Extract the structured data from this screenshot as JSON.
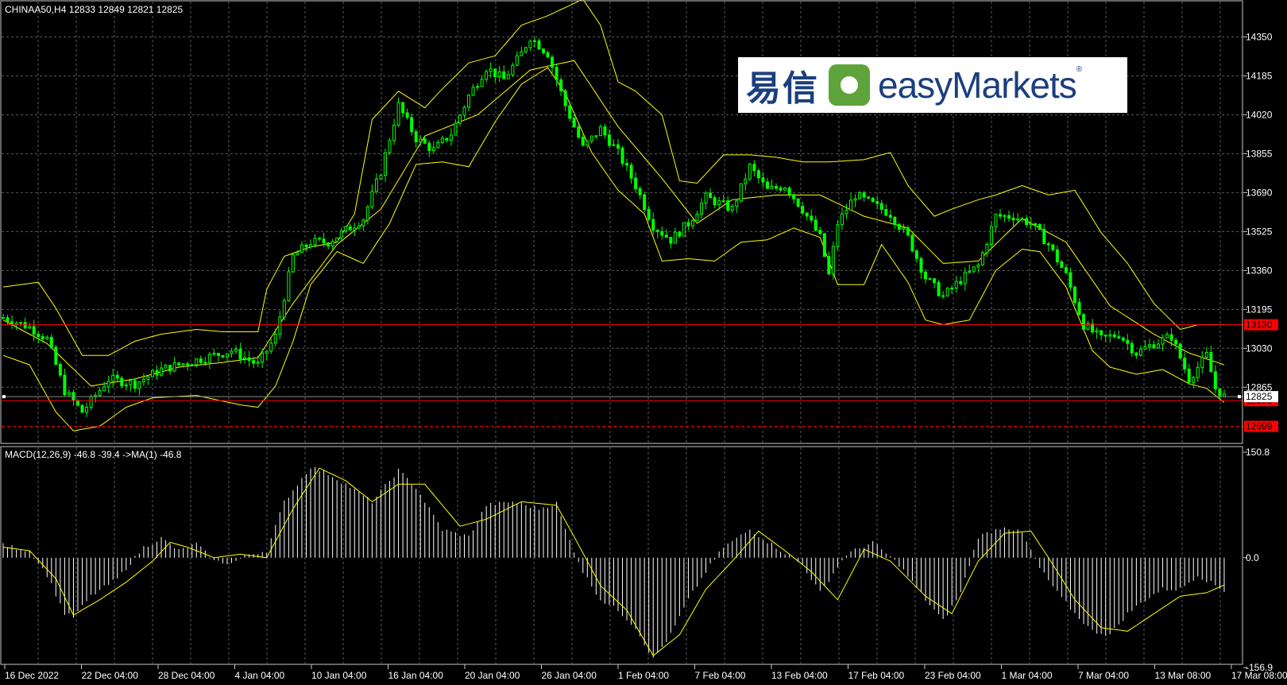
{
  "window": {
    "header": "CHINAA50,H4  12833 12849 12821 12825",
    "macd_label": "MACD(12,26,9) -46.8 -39.4  ->MA(1) -46.8"
  },
  "logo": {
    "cn": "易信",
    "en": "easyMarkets",
    "reg": "®"
  },
  "colors": {
    "candles": "#00ff00",
    "bands": "#ffff00",
    "macd_hist": "#ffffff",
    "macd_signal": "#ffff00",
    "levels": "#ff0000",
    "grid": "#5a5a5a"
  },
  "chart_data": [
    {
      "type": "candlestick",
      "symbol": "CHINAA50",
      "timeframe": "H4",
      "y_ticks": [
        14350,
        14185,
        14020,
        13855,
        13690,
        13525,
        13360,
        13195,
        13030,
        12865
      ],
      "x_ticks": [
        "16 Dec 2022",
        "22 Dec 04:00",
        "28 Dec 04:00",
        "4 Jan 04:00",
        "10 Jan 04:00",
        "16 Jan 04:00",
        "20 Jan 04:00",
        "26 Jan 04:00",
        "1 Feb 04:00",
        "7 Feb 04:00",
        "13 Feb 04:00",
        "17 Feb 04:00",
        "23 Feb 04:00",
        "1 Mar 04:00",
        "7 Mar 04:00",
        "13 Mar 08:00",
        "17 Mar 08:00"
      ],
      "ylim": [
        12630,
        14500
      ],
      "close_path": [
        [
          0,
          13160
        ],
        [
          6,
          13120
        ],
        [
          10,
          13070
        ],
        [
          14,
          12850
        ],
        [
          18,
          12760
        ],
        [
          24,
          12900
        ],
        [
          30,
          12880
        ],
        [
          36,
          12940
        ],
        [
          40,
          12960
        ],
        [
          46,
          12990
        ],
        [
          52,
          13020
        ],
        [
          58,
          12960
        ],
        [
          62,
          13080
        ],
        [
          66,
          13420
        ],
        [
          70,
          13480
        ],
        [
          74,
          13480
        ],
        [
          78,
          13530
        ],
        [
          82,
          13580
        ],
        [
          86,
          13780
        ],
        [
          90,
          14060
        ],
        [
          94,
          13920
        ],
        [
          98,
          13870
        ],
        [
          102,
          13940
        ],
        [
          106,
          14100
        ],
        [
          110,
          14220
        ],
        [
          114,
          14170
        ],
        [
          118,
          14280
        ],
        [
          120,
          14350
        ],
        [
          124,
          14280
        ],
        [
          128,
          14060
        ],
        [
          132,
          13880
        ],
        [
          136,
          13960
        ],
        [
          140,
          13860
        ],
        [
          144,
          13720
        ],
        [
          148,
          13550
        ],
        [
          152,
          13490
        ],
        [
          156,
          13560
        ],
        [
          160,
          13670
        ],
        [
          166,
          13620
        ],
        [
          170,
          13800
        ],
        [
          174,
          13700
        ],
        [
          178,
          13720
        ],
        [
          182,
          13620
        ],
        [
          186,
          13500
        ],
        [
          188,
          13340
        ],
        [
          190,
          13560
        ],
        [
          194,
          13680
        ],
        [
          198,
          13640
        ],
        [
          202,
          13600
        ],
        [
          206,
          13500
        ],
        [
          210,
          13330
        ],
        [
          214,
          13250
        ],
        [
          218,
          13320
        ],
        [
          222,
          13380
        ],
        [
          226,
          13590
        ],
        [
          230,
          13590
        ],
        [
          234,
          13560
        ],
        [
          238,
          13470
        ],
        [
          242,
          13340
        ],
        [
          246,
          13130
        ],
        [
          250,
          13070
        ],
        [
          254,
          13090
        ],
        [
          258,
          13010
        ],
        [
          262,
          13050
        ],
        [
          266,
          13080
        ],
        [
          270,
          12900
        ],
        [
          274,
          13000
        ],
        [
          276,
          12860
        ],
        [
          278,
          12825
        ]
      ],
      "upper_band_path": [
        [
          0,
          13290
        ],
        [
          8,
          13310
        ],
        [
          12,
          13200
        ],
        [
          18,
          13000
        ],
        [
          24,
          13000
        ],
        [
          30,
          13060
        ],
        [
          36,
          13090
        ],
        [
          44,
          13110
        ],
        [
          50,
          13100
        ],
        [
          58,
          13100
        ],
        [
          60,
          13280
        ],
        [
          64,
          13420
        ],
        [
          70,
          13460
        ],
        [
          76,
          13480
        ],
        [
          80,
          13600
        ],
        [
          84,
          14000
        ],
        [
          90,
          14120
        ],
        [
          96,
          14050
        ],
        [
          100,
          14130
        ],
        [
          106,
          14240
        ],
        [
          112,
          14270
        ],
        [
          118,
          14400
        ],
        [
          124,
          14440
        ],
        [
          132,
          14510
        ],
        [
          136,
          14400
        ],
        [
          140,
          14160
        ],
        [
          144,
          14120
        ],
        [
          150,
          14020
        ],
        [
          154,
          13740
        ],
        [
          158,
          13730
        ],
        [
          164,
          13850
        ],
        [
          170,
          13850
        ],
        [
          176,
          13840
        ],
        [
          182,
          13820
        ],
        [
          188,
          13820
        ],
        [
          196,
          13830
        ],
        [
          202,
          13860
        ],
        [
          206,
          13720
        ],
        [
          212,
          13590
        ],
        [
          216,
          13620
        ],
        [
          222,
          13660
        ],
        [
          226,
          13680
        ],
        [
          232,
          13720
        ],
        [
          238,
          13680
        ],
        [
          244,
          13700
        ],
        [
          250,
          13520
        ],
        [
          256,
          13390
        ],
        [
          262,
          13220
        ],
        [
          268,
          13110
        ],
        [
          272,
          13130
        ],
        [
          276,
          13130
        ]
      ],
      "lower_band_path": [
        [
          0,
          13000
        ],
        [
          6,
          12960
        ],
        [
          12,
          12760
        ],
        [
          16,
          12680
        ],
        [
          22,
          12700
        ],
        [
          28,
          12780
        ],
        [
          34,
          12820
        ],
        [
          44,
          12830
        ],
        [
          54,
          12790
        ],
        [
          58,
          12780
        ],
        [
          62,
          12870
        ],
        [
          66,
          13060
        ],
        [
          70,
          13300
        ],
        [
          76,
          13440
        ],
        [
          82,
          13390
        ],
        [
          88,
          13560
        ],
        [
          94,
          13810
        ],
        [
          100,
          13820
        ],
        [
          106,
          13800
        ],
        [
          112,
          13990
        ],
        [
          118,
          14150
        ],
        [
          124,
          14220
        ],
        [
          128,
          14110
        ],
        [
          134,
          13860
        ],
        [
          140,
          13700
        ],
        [
          146,
          13600
        ],
        [
          150,
          13400
        ],
        [
          156,
          13410
        ],
        [
          162,
          13400
        ],
        [
          168,
          13480
        ],
        [
          174,
          13490
        ],
        [
          180,
          13540
        ],
        [
          186,
          13500
        ],
        [
          190,
          13300
        ],
        [
          196,
          13300
        ],
        [
          200,
          13470
        ],
        [
          206,
          13310
        ],
        [
          210,
          13150
        ],
        [
          214,
          13130
        ],
        [
          220,
          13150
        ],
        [
          226,
          13360
        ],
        [
          232,
          13450
        ],
        [
          236,
          13440
        ],
        [
          242,
          13290
        ],
        [
          248,
          13020
        ],
        [
          252,
          12950
        ],
        [
          258,
          12920
        ],
        [
          264,
          12940
        ],
        [
          270,
          12880
        ],
        [
          274,
          12860
        ],
        [
          278,
          12800
        ]
      ],
      "middle_band_path": [
        [
          0,
          13150
        ],
        [
          10,
          13050
        ],
        [
          20,
          12870
        ],
        [
          30,
          12900
        ],
        [
          40,
          12950
        ],
        [
          50,
          12970
        ],
        [
          58,
          12990
        ],
        [
          66,
          13220
        ],
        [
          76,
          13470
        ],
        [
          86,
          13620
        ],
        [
          96,
          13930
        ],
        [
          108,
          14020
        ],
        [
          120,
          14210
        ],
        [
          130,
          14250
        ],
        [
          140,
          13970
        ],
        [
          150,
          13750
        ],
        [
          158,
          13560
        ],
        [
          166,
          13660
        ],
        [
          176,
          13680
        ],
        [
          186,
          13680
        ],
        [
          196,
          13590
        ],
        [
          206,
          13540
        ],
        [
          214,
          13390
        ],
        [
          222,
          13400
        ],
        [
          232,
          13580
        ],
        [
          242,
          13480
        ],
        [
          252,
          13210
        ],
        [
          262,
          13090
        ],
        [
          270,
          13010
        ],
        [
          278,
          12960
        ]
      ],
      "levels": [
        {
          "value": 13130,
          "label": "13130",
          "style": "solid"
        },
        {
          "value": 12808,
          "label": "12808",
          "style": "solid"
        },
        {
          "value": 12699,
          "label": "12699",
          "style": "dashed"
        }
      ],
      "current_price": {
        "value": 12825,
        "label": "12825"
      },
      "start_marker": {
        "x": 0,
        "value": 12825
      }
    },
    {
      "type": "histogram",
      "title": "MACD(12,26,9) -46.8 -39.4  ->MA(1) -46.8",
      "y_ticks": [
        150.8,
        0.0,
        -156.9
      ],
      "ylim": [
        -156.9,
        150.8
      ],
      "hist_path": [
        [
          0,
          18
        ],
        [
          6,
          10
        ],
        [
          10,
          -25
        ],
        [
          14,
          -80
        ],
        [
          16,
          -85
        ],
        [
          20,
          -55
        ],
        [
          26,
          -30
        ],
        [
          32,
          15
        ],
        [
          36,
          28
        ],
        [
          40,
          10
        ],
        [
          44,
          20
        ],
        [
          48,
          -5
        ],
        [
          52,
          -8
        ],
        [
          56,
          5
        ],
        [
          60,
          10
        ],
        [
          64,
          80
        ],
        [
          70,
          130
        ],
        [
          74,
          120
        ],
        [
          78,
          105
        ],
        [
          84,
          80
        ],
        [
          90,
          125
        ],
        [
          94,
          100
        ],
        [
          100,
          40
        ],
        [
          106,
          30
        ],
        [
          110,
          75
        ],
        [
          116,
          80
        ],
        [
          122,
          70
        ],
        [
          126,
          78
        ],
        [
          128,
          40
        ],
        [
          132,
          -20
        ],
        [
          136,
          -60
        ],
        [
          140,
          -75
        ],
        [
          144,
          -100
        ],
        [
          148,
          -145
        ],
        [
          152,
          -110
        ],
        [
          156,
          -60
        ],
        [
          160,
          -20
        ],
        [
          164,
          15
        ],
        [
          170,
          40
        ],
        [
          176,
          15
        ],
        [
          182,
          -10
        ],
        [
          186,
          -50
        ],
        [
          192,
          5
        ],
        [
          198,
          22
        ],
        [
          204,
          -10
        ],
        [
          210,
          -60
        ],
        [
          214,
          -90
        ],
        [
          218,
          -50
        ],
        [
          222,
          30
        ],
        [
          228,
          45
        ],
        [
          232,
          35
        ],
        [
          236,
          -15
        ],
        [
          240,
          -50
        ],
        [
          244,
          -80
        ],
        [
          248,
          -105
        ],
        [
          252,
          -110
        ],
        [
          256,
          -80
        ],
        [
          260,
          -60
        ],
        [
          264,
          -45
        ],
        [
          268,
          -45
        ],
        [
          272,
          -25
        ],
        [
          278,
          -47
        ]
      ],
      "signal_path": [
        [
          0,
          15
        ],
        [
          6,
          10
        ],
        [
          12,
          -30
        ],
        [
          16,
          -82
        ],
        [
          22,
          -60
        ],
        [
          28,
          -35
        ],
        [
          34,
          -5
        ],
        [
          38,
          22
        ],
        [
          42,
          15
        ],
        [
          48,
          0
        ],
        [
          54,
          5
        ],
        [
          60,
          0
        ],
        [
          66,
          70
        ],
        [
          72,
          128
        ],
        [
          78,
          110
        ],
        [
          84,
          80
        ],
        [
          90,
          105
        ],
        [
          96,
          105
        ],
        [
          104,
          45
        ],
        [
          110,
          55
        ],
        [
          118,
          80
        ],
        [
          126,
          75
        ],
        [
          130,
          30
        ],
        [
          136,
          -40
        ],
        [
          142,
          -75
        ],
        [
          148,
          -140
        ],
        [
          154,
          -110
        ],
        [
          160,
          -45
        ],
        [
          166,
          -5
        ],
        [
          172,
          38
        ],
        [
          178,
          10
        ],
        [
          184,
          -20
        ],
        [
          190,
          -60
        ],
        [
          196,
          12
        ],
        [
          202,
          -5
        ],
        [
          210,
          -55
        ],
        [
          216,
          -80
        ],
        [
          222,
          -5
        ],
        [
          228,
          35
        ],
        [
          234,
          38
        ],
        [
          238,
          0
        ],
        [
          244,
          -60
        ],
        [
          250,
          -100
        ],
        [
          256,
          -105
        ],
        [
          262,
          -80
        ],
        [
          268,
          -55
        ],
        [
          274,
          -50
        ],
        [
          278,
          -39
        ]
      ]
    }
  ]
}
